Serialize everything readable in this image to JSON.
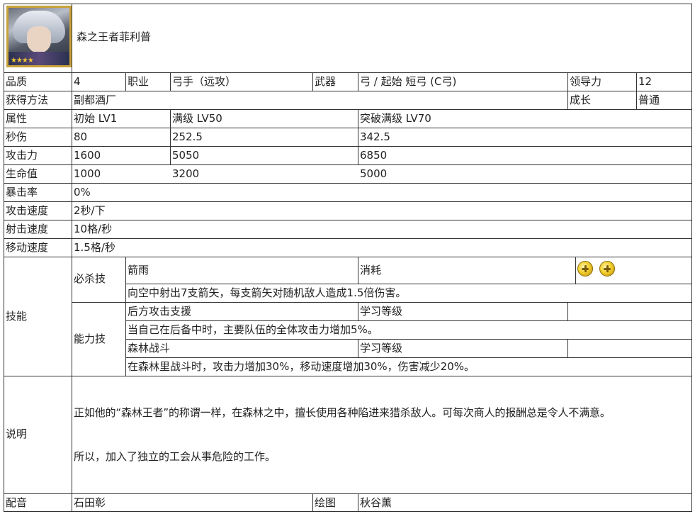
{
  "name": "森之王者菲利普",
  "row1": {
    "quality_label": "品质",
    "quality": "4",
    "job_label": "职业",
    "job": "弓手（远攻）",
    "weapon_label": "武器",
    "weapon": "弓 / 起始 短弓 (C弓)",
    "leadership_label": "领导力",
    "leadership": "12"
  },
  "row2": {
    "obtain_label": "获得方法",
    "obtain": "副都酒厂",
    "growth_label": "成长",
    "growth": "普通"
  },
  "stats": {
    "attr_label": "属性",
    "lv1": "初始 LV1",
    "lv50": "满级 LV50",
    "lv70": "突破满级 LV70",
    "dps_label": "秒伤",
    "dps": [
      "80",
      "252.5",
      "342.5"
    ],
    "atk_label": "攻击力",
    "atk": [
      "1600",
      "5050",
      "6850"
    ],
    "hp_label": "生命值",
    "hp": [
      "1000",
      "3200",
      "5000"
    ],
    "crit_label": "暴击率",
    "crit": "0%",
    "atkspd_label": "攻击速度",
    "atkspd": "2秒/下",
    "shotspd_label": "射击速度",
    "shotspd": "10格/秒",
    "movespd_label": "移动速度",
    "movespd": "1.5格/秒"
  },
  "skills": {
    "label": "技能",
    "special_label": "必杀技",
    "special_name": "箭雨",
    "cost_label": "消耗",
    "special_desc": "向空中射出7支箭矢，每支箭矢对随机敌人造成1.5倍伤害。",
    "ability_label": "能力技",
    "ability1_name": "后方攻击支援",
    "learn_label1": "学习等级",
    "ability1_desc": "当自己在后备中时，主要队伍的全体攻击力增加5%。",
    "ability2_name": "森林战斗",
    "learn_label2": "学习等级",
    "ability2_desc": "在森林里战斗时，攻击力增加30%，移动速度增加30%，伤害减少20%。"
  },
  "desc": {
    "label": "说明",
    "p1": "正如他的“森林王者”的称谓一样，在森林之中，擅长使用各种陷进来猎杀敌人。可每次商人的报酬总是令人不满意。",
    "p2": "所以，加入了独立的工会从事危险的工作。"
  },
  "credits": {
    "cv_label": "配音",
    "cv": "石田彰",
    "art_label": "绘图",
    "art": "秋谷薰"
  },
  "icons": {
    "cost_icon": "coin-icon",
    "stars": "★★★★"
  }
}
